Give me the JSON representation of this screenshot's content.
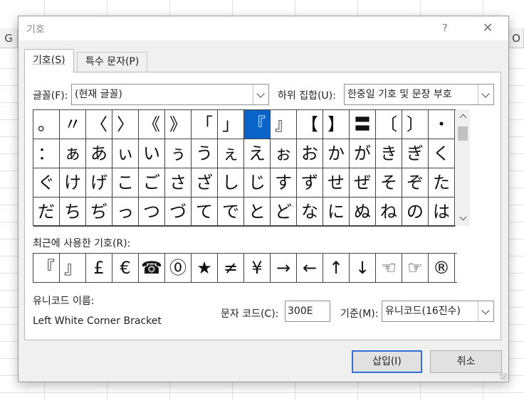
{
  "spreadsheet": {
    "col_left": "G",
    "col_right": "O"
  },
  "dialog": {
    "title": "기호",
    "help_glyph": "?",
    "close_glyph": "✕"
  },
  "tabs": [
    {
      "label": "기호(S)",
      "active": true
    },
    {
      "label": "특수 문자(P)",
      "active": false
    }
  ],
  "font": {
    "label": "글꼴(F):",
    "value": "(현재 글꼴)"
  },
  "subset": {
    "label": "하위 집합(U):",
    "value": "한중일 기호 및 문장 부호"
  },
  "symbols": {
    "rows": [
      [
        "。",
        "〃",
        "〈",
        "〉",
        "《",
        "》",
        "「",
        "」",
        "『",
        "』",
        "【",
        "】",
        "〓",
        "〔",
        "〕",
        "・"
      ],
      [
        "：",
        "ぁ",
        "あ",
        "ぃ",
        "い",
        "ぅ",
        "う",
        "ぇ",
        "え",
        "ぉ",
        "お",
        "か",
        "が",
        "き",
        "ぎ",
        "く"
      ],
      [
        "ぐ",
        "け",
        "げ",
        "こ",
        "ご",
        "さ",
        "ざ",
        "し",
        "じ",
        "す",
        "ず",
        "せ",
        "ぜ",
        "そ",
        "ぞ",
        "た"
      ],
      [
        "だ",
        "ち",
        "ぢ",
        "っ",
        "つ",
        "づ",
        "て",
        "で",
        "と",
        "ど",
        "な",
        "に",
        "ぬ",
        "ね",
        "の",
        "は"
      ]
    ],
    "selected_row": 0,
    "selected_col": 8
  },
  "recent": {
    "label": "최근에 사용한 기호(R):",
    "items": [
      "『",
      "』",
      "£",
      "€",
      "☎",
      "⓪",
      "★",
      "≠",
      "¥",
      "→",
      "←",
      "↑",
      "↓",
      "☜",
      "☞",
      "®"
    ]
  },
  "unicode_name": {
    "label": "유니코드 이름:",
    "value": "Left White Corner Bracket"
  },
  "char_code": {
    "label": "문자 코드(C):",
    "value": "300E"
  },
  "from": {
    "label": "기준(M):",
    "value": "유니코드(16진수)"
  },
  "buttons": {
    "insert": "삽입(I)",
    "cancel": "취소"
  }
}
